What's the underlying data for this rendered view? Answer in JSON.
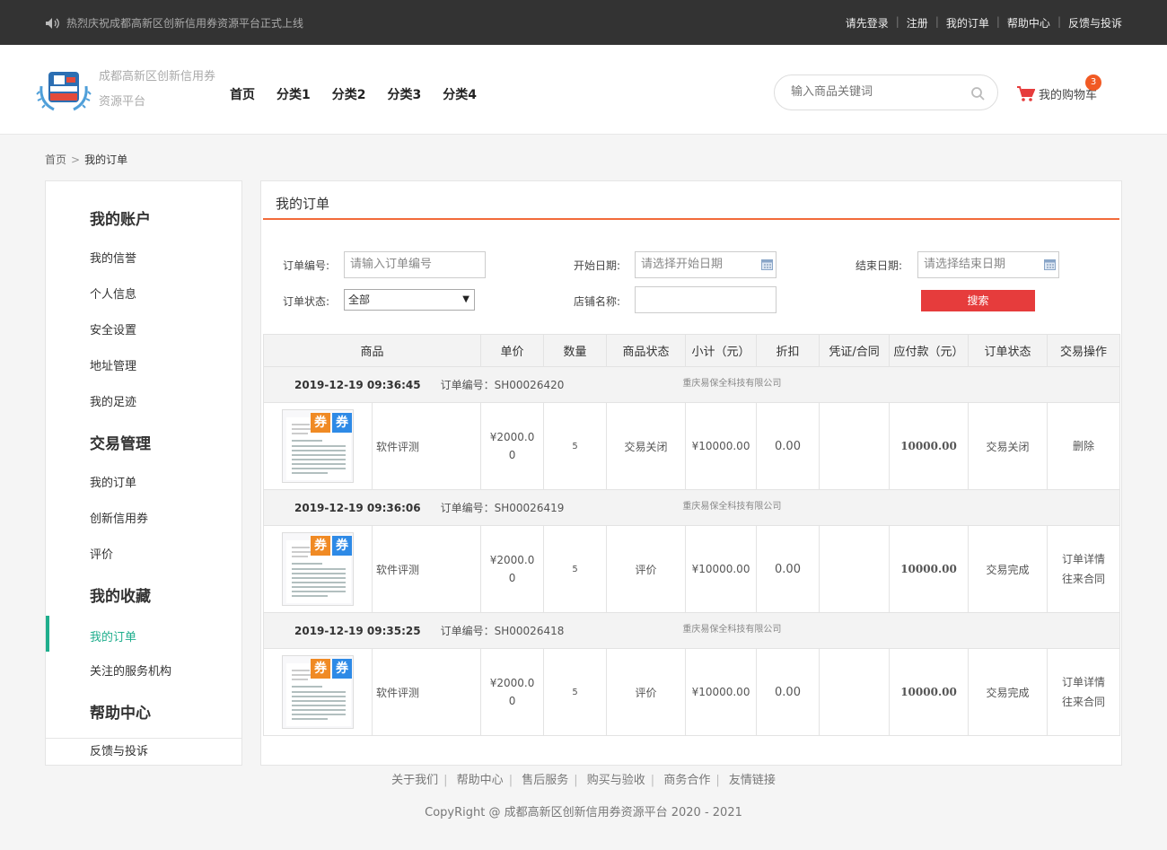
{
  "topbar": {
    "notice": "热烈庆祝成都高新区创新信用券资源平台正式上线",
    "links": [
      "请先登录",
      "注册",
      "我的订单",
      "帮助中心",
      "反馈与投诉"
    ]
  },
  "header": {
    "brand": "成都高新区创新信用券资源平台",
    "nav": [
      "首页",
      "分类1",
      "分类2",
      "分类3",
      "分类4"
    ],
    "search_placeholder": "输入商品关键词",
    "cart_label": "我的购物车",
    "cart_count": "3"
  },
  "breadcrumb": {
    "home": "首页",
    "sep": ">",
    "current": "我的订单"
  },
  "sidebar": {
    "groups": [
      {
        "title": "我的账户",
        "items": [
          "我的信誉",
          "个人信息",
          "安全设置",
          "地址管理",
          "我的足迹"
        ]
      },
      {
        "title": "交易管理",
        "items": [
          "我的订单",
          "创新信用券",
          "评价"
        ]
      },
      {
        "title": "我的收藏",
        "items": [
          "我的订单",
          "关注的服务机构"
        ]
      },
      {
        "title": "帮助中心",
        "items": [
          "反馈与投诉"
        ]
      }
    ]
  },
  "main": {
    "title": "我的订单",
    "filters": {
      "order_no_label": "订单编号:",
      "order_no_placeholder": "请输入订单编号",
      "start_label": "开始日期:",
      "start_placeholder": "请选择开始日期",
      "end_label": "结束日期:",
      "end_placeholder": "请选择结束日期",
      "status_label": "订单状态:",
      "status_value": "全部",
      "shop_label": "店铺名称:",
      "shop_value": "",
      "search_button": "搜索"
    },
    "columns": [
      "商品",
      "单价",
      "数量",
      "商品状态",
      "小计（元）",
      "折扣",
      "凭证/合同",
      "应付款（元）",
      "订单状态",
      "交易操作"
    ],
    "orders": [
      {
        "date": "2019-12-19 09:36:45",
        "order_no": "订单编号：SH00026420",
        "shop": "重庆易保全科技有限公司",
        "product": "软件评测",
        "unit_price": "¥2000.00",
        "qty": "5",
        "item_status": "交易关闭",
        "subtotal": "¥10000.00",
        "discount": "0.00",
        "voucher": "",
        "payable": "10000.00",
        "order_status": "交易关闭",
        "actions": [
          "删除"
        ]
      },
      {
        "date": "2019-12-19 09:36:06",
        "order_no": "订单编号：SH00026419",
        "shop": "重庆易保全科技有限公司",
        "product": "软件评测",
        "unit_price": "¥2000.00",
        "qty": "5",
        "item_status": "评价",
        "subtotal": "¥10000.00",
        "discount": "0.00",
        "voucher": "",
        "payable": "10000.00",
        "order_status": "交易完成",
        "actions": [
          "订单详情",
          "往来合同"
        ]
      },
      {
        "date": "2019-12-19 09:35:25",
        "order_no": "订单编号：SH00026418",
        "shop": "重庆易保全科技有限公司",
        "product": "软件评测",
        "unit_price": "¥2000.00",
        "qty": "5",
        "item_status": "评价",
        "subtotal": "¥10000.00",
        "discount": "0.00",
        "voucher": "",
        "payable": "10000.00",
        "order_status": "交易完成",
        "actions": [
          "订单详情",
          "往来合同"
        ]
      }
    ],
    "thumb_badge": "券"
  },
  "footer": {
    "links": [
      "关于我们",
      "帮助中心",
      "售后服务",
      "购买与验收",
      "商务合作",
      "友情链接"
    ],
    "copyright": "CopyRight @ 成都高新区创新信用券资源平台 2020 - 2021"
  },
  "colors": {
    "accent_orange": "#f26b3a",
    "active_green": "#1fae8d",
    "button_red": "#e63c3c",
    "topbar": "#333333"
  }
}
